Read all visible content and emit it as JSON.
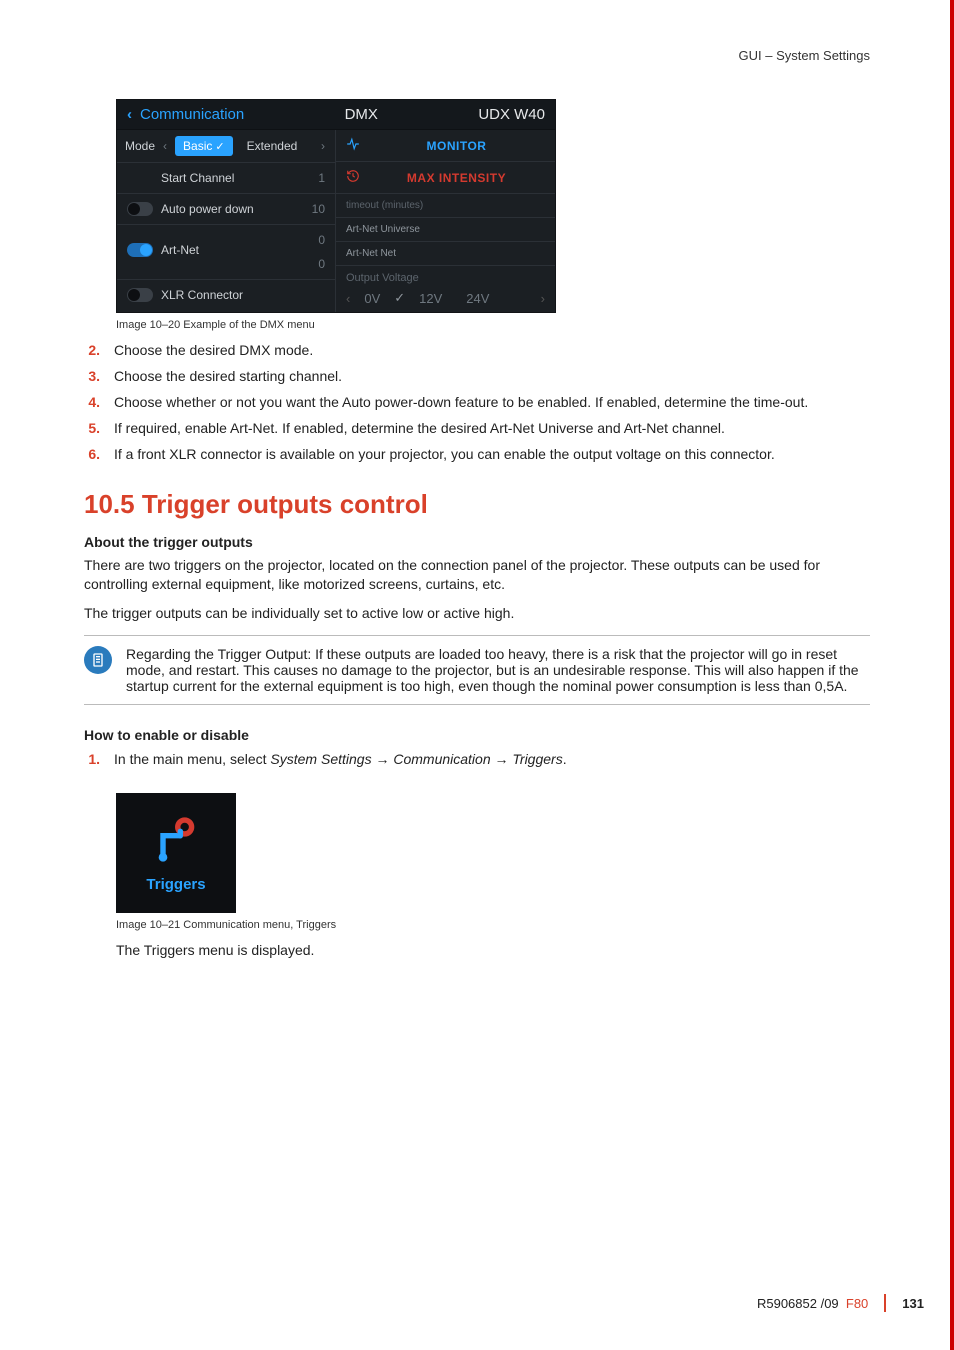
{
  "header": {
    "section": "GUI – System Settings"
  },
  "ui": {
    "titlebar": {
      "back_chevron": "‹",
      "communication": "Communication",
      "center": "DMX",
      "right": "UDX W40"
    },
    "left": {
      "mode_label": "Mode",
      "arrow_left": "‹",
      "arrow_right": "›",
      "mode_basic": "Basic",
      "mode_extended": "Extended",
      "start_channel_label": "Start Channel",
      "start_channel_value": "1",
      "auto_power_down_label": "Auto power down",
      "auto_power_down_value": "10",
      "artnet_label": "Art-Net",
      "artnet_v1": "0",
      "artnet_v2": "0",
      "xlr_label": "XLR Connector"
    },
    "right": {
      "monitor": "MONITOR",
      "max_intensity": "MAX INTENSITY",
      "timeout_label": "timeout (minutes)",
      "artnet_universe": "Art-Net Universe",
      "artnet_net": "Art-Net Net",
      "output_voltage_label": "Output Voltage",
      "ov_0v": "0V",
      "ov_12v": "12V",
      "ov_24v": "24V"
    }
  },
  "captions": {
    "img1020": "Image 10–20  Example of the DMX menu",
    "img1021": "Image 10–21  Communication menu, Triggers"
  },
  "steps_a": {
    "s2": "Choose the desired DMX mode.",
    "s3": "Choose the desired starting channel.",
    "s4": "Choose whether or not you want the Auto power-down feature to be enabled. If enabled, determine the time-out.",
    "s5": "If required, enable Art-Net. If enabled, determine the desired Art-Net Universe and Art-Net channel.",
    "s6": "If a front XLR connector is available on your projector, you can enable the output voltage on this connector."
  },
  "section10_5": {
    "title": "10.5 Trigger outputs control",
    "about_heading": "About the trigger outputs",
    "about_p1": "There are two triggers on the projector, located on the connection panel of the projector. These outputs can be used for controlling external equipment, like motorized screens, curtains, etc.",
    "about_p2": "The trigger outputs can be individually set to active low or active high.",
    "note": "Regarding the Trigger Output: If these outputs are loaded too heavy, there is a risk that the projector will go in reset mode, and restart. This causes no damage to the projector, but is an undesirable response. This will also happen if the startup current for the external equipment is too high, even though the nominal power consumption is less than 0,5A.",
    "how_heading": "How to enable or disable",
    "step1_pre": "In the main menu, select ",
    "step1_path": "System Settings → Communication → Triggers",
    "step1_post": ".",
    "triggers_label": "Triggers",
    "after_tile": "The Triggers menu is displayed."
  },
  "footer": {
    "doc": "R5906852 /09",
    "model": "F80",
    "page": "131"
  }
}
